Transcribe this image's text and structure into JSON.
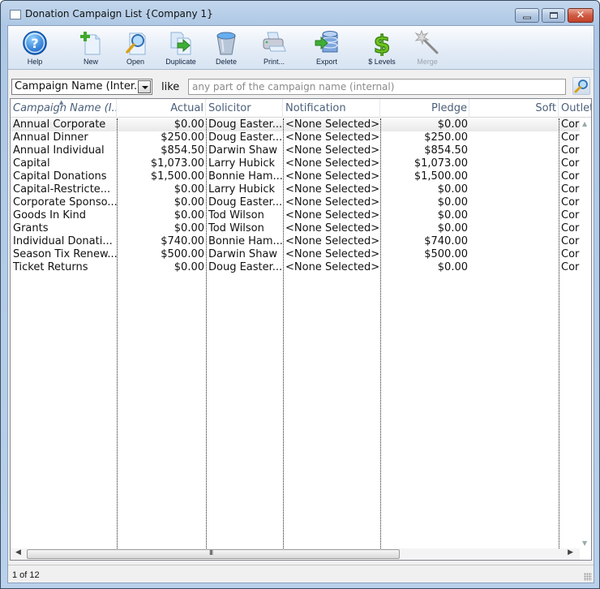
{
  "window": {
    "title": "Donation Campaign List {Company 1}",
    "controls": {
      "minimize": "minimize",
      "maximize": "maximize",
      "close": "✕"
    }
  },
  "toolbar": {
    "buttons": [
      {
        "label": "Help",
        "icon": "help-icon",
        "enabled": true
      },
      {
        "label": "New",
        "icon": "new-document-icon",
        "enabled": true
      },
      {
        "label": "Open",
        "icon": "magnifier-icon",
        "enabled": true
      },
      {
        "label": "Duplicate",
        "icon": "duplicate-icon",
        "enabled": true
      },
      {
        "label": "Delete",
        "icon": "trash-bin-icon",
        "enabled": true
      },
      {
        "label": "Print...",
        "icon": "printer-icon",
        "enabled": true
      },
      {
        "label": "Export",
        "icon": "database-export-icon",
        "enabled": true
      },
      {
        "label": "$ Levels",
        "icon": "dollar-sign-icon",
        "enabled": true
      },
      {
        "label": "Merge",
        "icon": "magic-wand-icon",
        "enabled": false
      }
    ]
  },
  "filter": {
    "field_selected": "Campaign Name (Inter...",
    "operator": "like",
    "search_value": "",
    "search_placeholder": "any part of the campaign name (internal)"
  },
  "grid": {
    "columns": [
      {
        "label": "Campaign Name (I...",
        "align": "left",
        "sorted": true
      },
      {
        "label": "Actual",
        "align": "right"
      },
      {
        "label": "Solicitor",
        "align": "left"
      },
      {
        "label": "Notification",
        "align": "left"
      },
      {
        "label": "Pledge",
        "align": "right"
      },
      {
        "label": "Soft",
        "align": "right"
      },
      {
        "label": "Outlet",
        "align": "left"
      }
    ],
    "rows": [
      {
        "name": "Annual Corporate",
        "actual": "$0.00",
        "solicitor": "Doug Easter...",
        "notification": "<None Selected>",
        "pledge": "$0.00",
        "soft": "",
        "outlet": "Cor"
      },
      {
        "name": "Annual Dinner",
        "actual": "$250.00",
        "solicitor": "Doug Easter...",
        "notification": "<None Selected>",
        "pledge": "$250.00",
        "soft": "",
        "outlet": "Cor"
      },
      {
        "name": "Annual Individual",
        "actual": "$854.50",
        "solicitor": "Darwin Shaw",
        "notification": "<None Selected>",
        "pledge": "$854.50",
        "soft": "",
        "outlet": "Cor"
      },
      {
        "name": "Capital",
        "actual": "$1,073.00",
        "solicitor": "Larry Hubick",
        "notification": "<None Selected>",
        "pledge": "$1,073.00",
        "soft": "",
        "outlet": "Cor"
      },
      {
        "name": "Capital Donations",
        "actual": "$1,500.00",
        "solicitor": "Bonnie Ham...",
        "notification": "<None Selected>",
        "pledge": "$1,500.00",
        "soft": "",
        "outlet": "Cor"
      },
      {
        "name": "Capital-Restricte...",
        "actual": "$0.00",
        "solicitor": "Larry Hubick",
        "notification": "<None Selected>",
        "pledge": "$0.00",
        "soft": "",
        "outlet": "Cor"
      },
      {
        "name": "Corporate Sponso...",
        "actual": "$0.00",
        "solicitor": "Doug Easter...",
        "notification": "<None Selected>",
        "pledge": "$0.00",
        "soft": "",
        "outlet": "Cor"
      },
      {
        "name": "Goods In Kind",
        "actual": "$0.00",
        "solicitor": "Tod Wilson",
        "notification": "<None Selected>",
        "pledge": "$0.00",
        "soft": "",
        "outlet": "Cor"
      },
      {
        "name": "Grants",
        "actual": "$0.00",
        "solicitor": "Tod Wilson",
        "notification": "<None Selected>",
        "pledge": "$0.00",
        "soft": "",
        "outlet": "Cor"
      },
      {
        "name": "Individual Donati...",
        "actual": "$740.00",
        "solicitor": "Bonnie Ham...",
        "notification": "<None Selected>",
        "pledge": "$740.00",
        "soft": "",
        "outlet": "Cor"
      },
      {
        "name": "Season Tix Renew...",
        "actual": "$500.00",
        "solicitor": "Darwin Shaw",
        "notification": "<None Selected>",
        "pledge": "$500.00",
        "soft": "",
        "outlet": "Cor"
      },
      {
        "name": "Ticket Returns",
        "actual": "$0.00",
        "solicitor": "Doug Easter...",
        "notification": "<None Selected>",
        "pledge": "$0.00",
        "soft": "",
        "outlet": "Cor"
      }
    ],
    "selected_row": 0,
    "hscroll_grip": "III"
  },
  "status": {
    "record_position": "1 of 12"
  },
  "colors": {
    "header_text": "#4c607a",
    "title_bar": "#b9d1ea",
    "close_button": "#c2412a",
    "selection": "#e9e9e9"
  }
}
